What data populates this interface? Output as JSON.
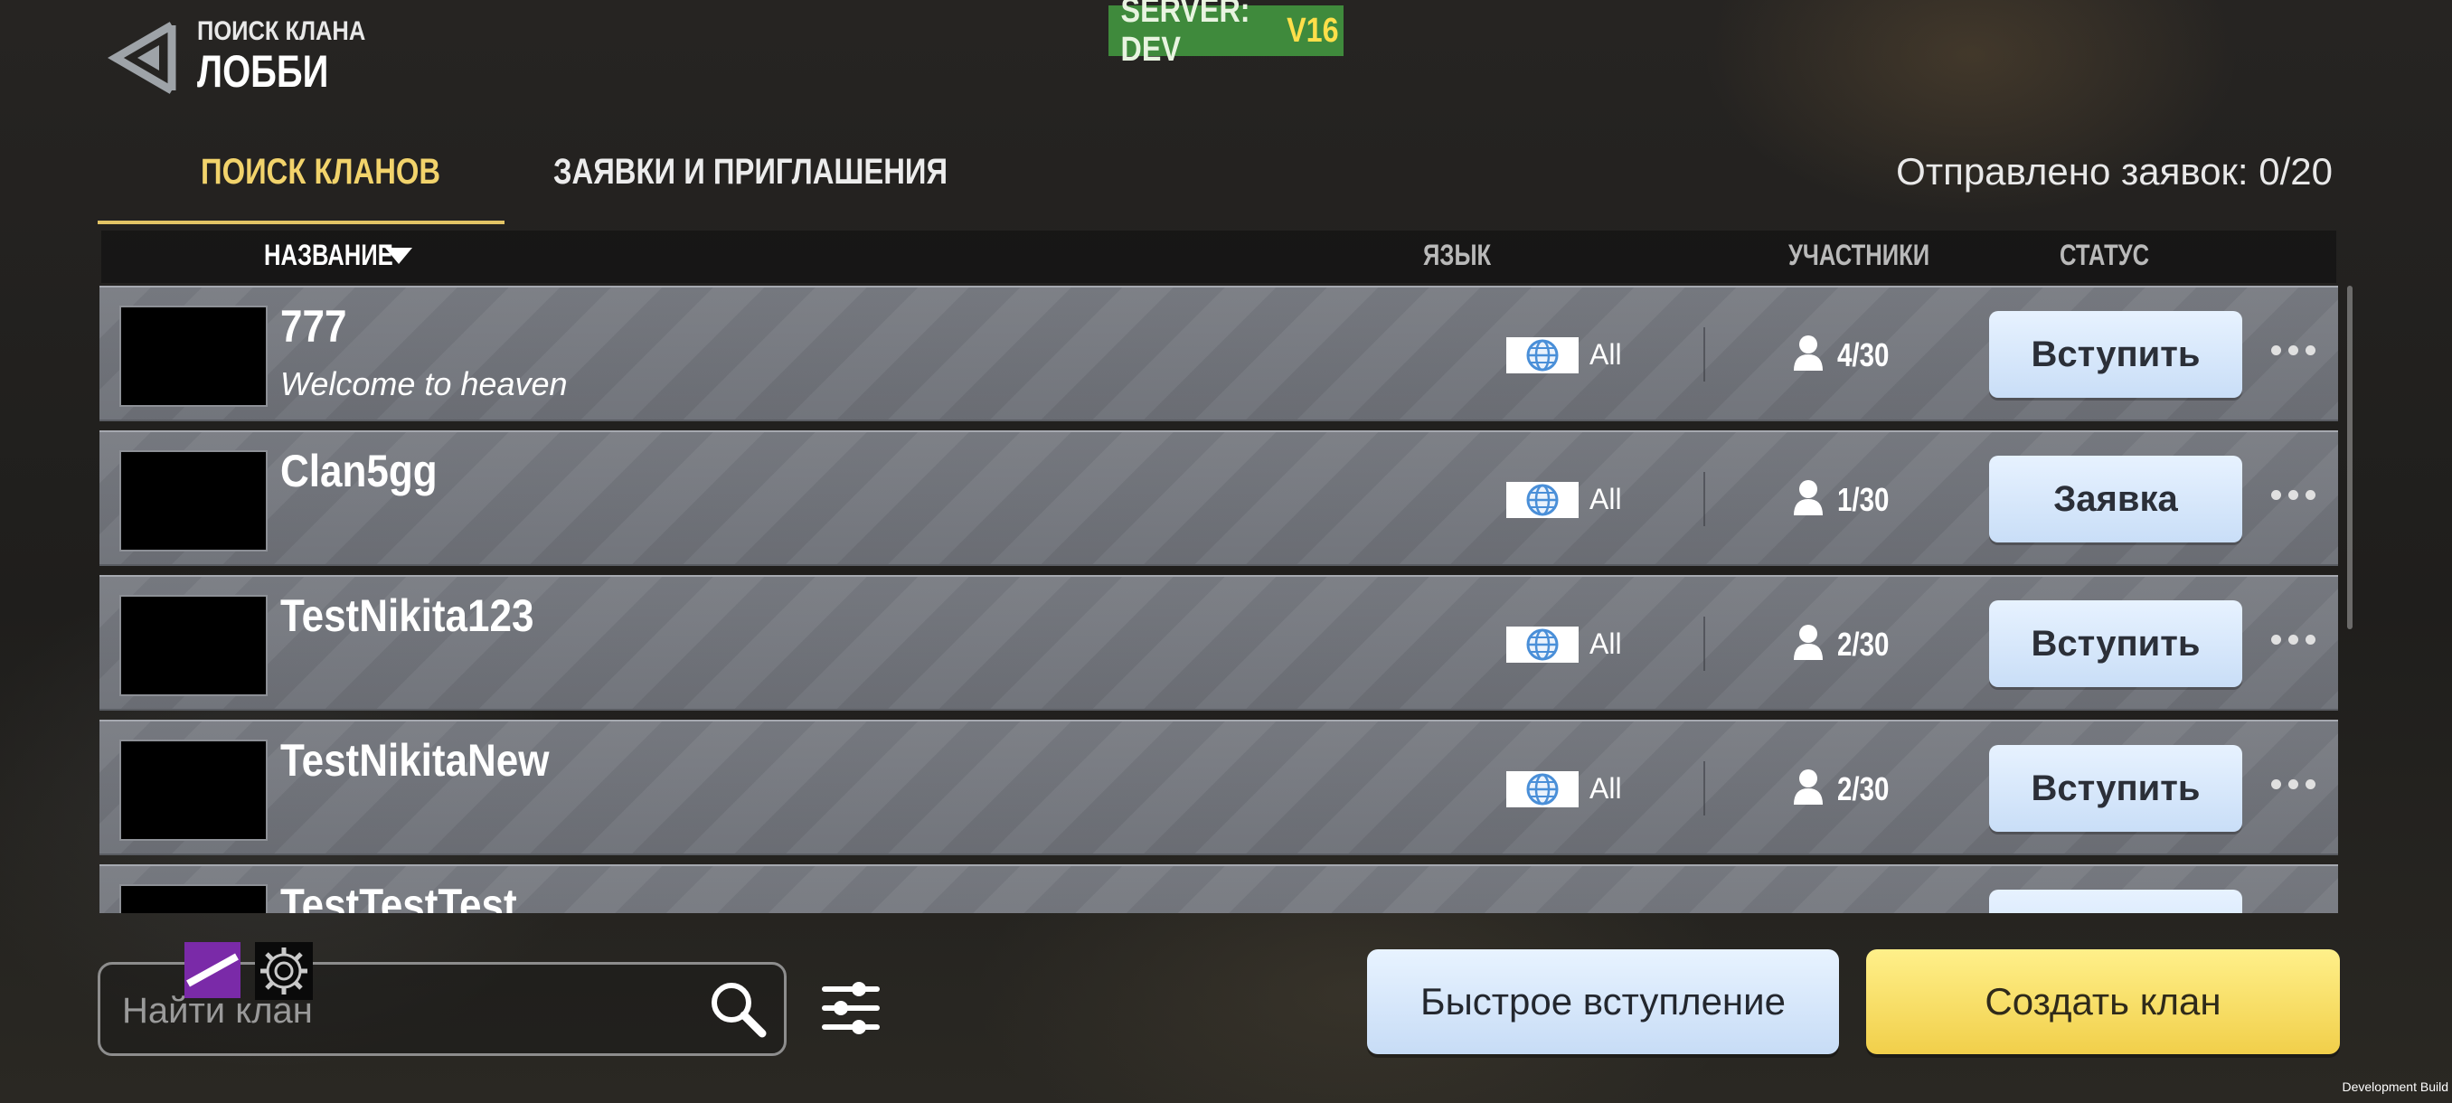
{
  "header": {
    "subtitle": "ПОИСК КЛАНА",
    "title": "ЛОББИ",
    "server_label": "SERVER: DEV",
    "server_version": "V16",
    "server_color": "#3f8a3c"
  },
  "tabs": [
    {
      "label": "ПОИСК КЛАНОВ",
      "active": true
    },
    {
      "label": "ЗАЯВКИ И ПРИГЛАШЕНИЯ",
      "active": false
    }
  ],
  "sent_requests": "Отправлено заявок: 0/20",
  "columns": {
    "name": "НАЗВАНИЕ",
    "language": "ЯЗЫК",
    "members": "УЧАСТНИКИ",
    "status": "СТАТУС"
  },
  "clans": [
    {
      "name": "777",
      "motto": "Welcome to heaven",
      "language": "All",
      "members": "4/30",
      "action": "Вступить"
    },
    {
      "name": "Clan5gg",
      "motto": "",
      "language": "All",
      "members": "1/30",
      "action": "Заявка"
    },
    {
      "name": "TestNikita123",
      "motto": "",
      "language": "All",
      "members": "2/30",
      "action": "Вступить"
    },
    {
      "name": "TestNikitaNew",
      "motto": "",
      "language": "All",
      "members": "2/30",
      "action": "Вступить"
    },
    {
      "name": "TestTestTest",
      "motto": "",
      "language": "",
      "members": "",
      "action": ""
    }
  ],
  "search": {
    "placeholder": "Найти клан"
  },
  "buttons": {
    "quick_join": "Быстрое вступление",
    "create_clan": "Создать клан"
  },
  "footer": {
    "dev_build": "Development Build"
  },
  "colors": {
    "accent_tab": "#e3c465",
    "primary_button": "#f1cf4a",
    "secondary_button": "#c7dcf6"
  },
  "icons": [
    "back-arrow-icon",
    "sort-desc-icon",
    "globe-icon",
    "person-icon",
    "more-icon",
    "search-icon",
    "filter-icon",
    "gear-icon"
  ]
}
